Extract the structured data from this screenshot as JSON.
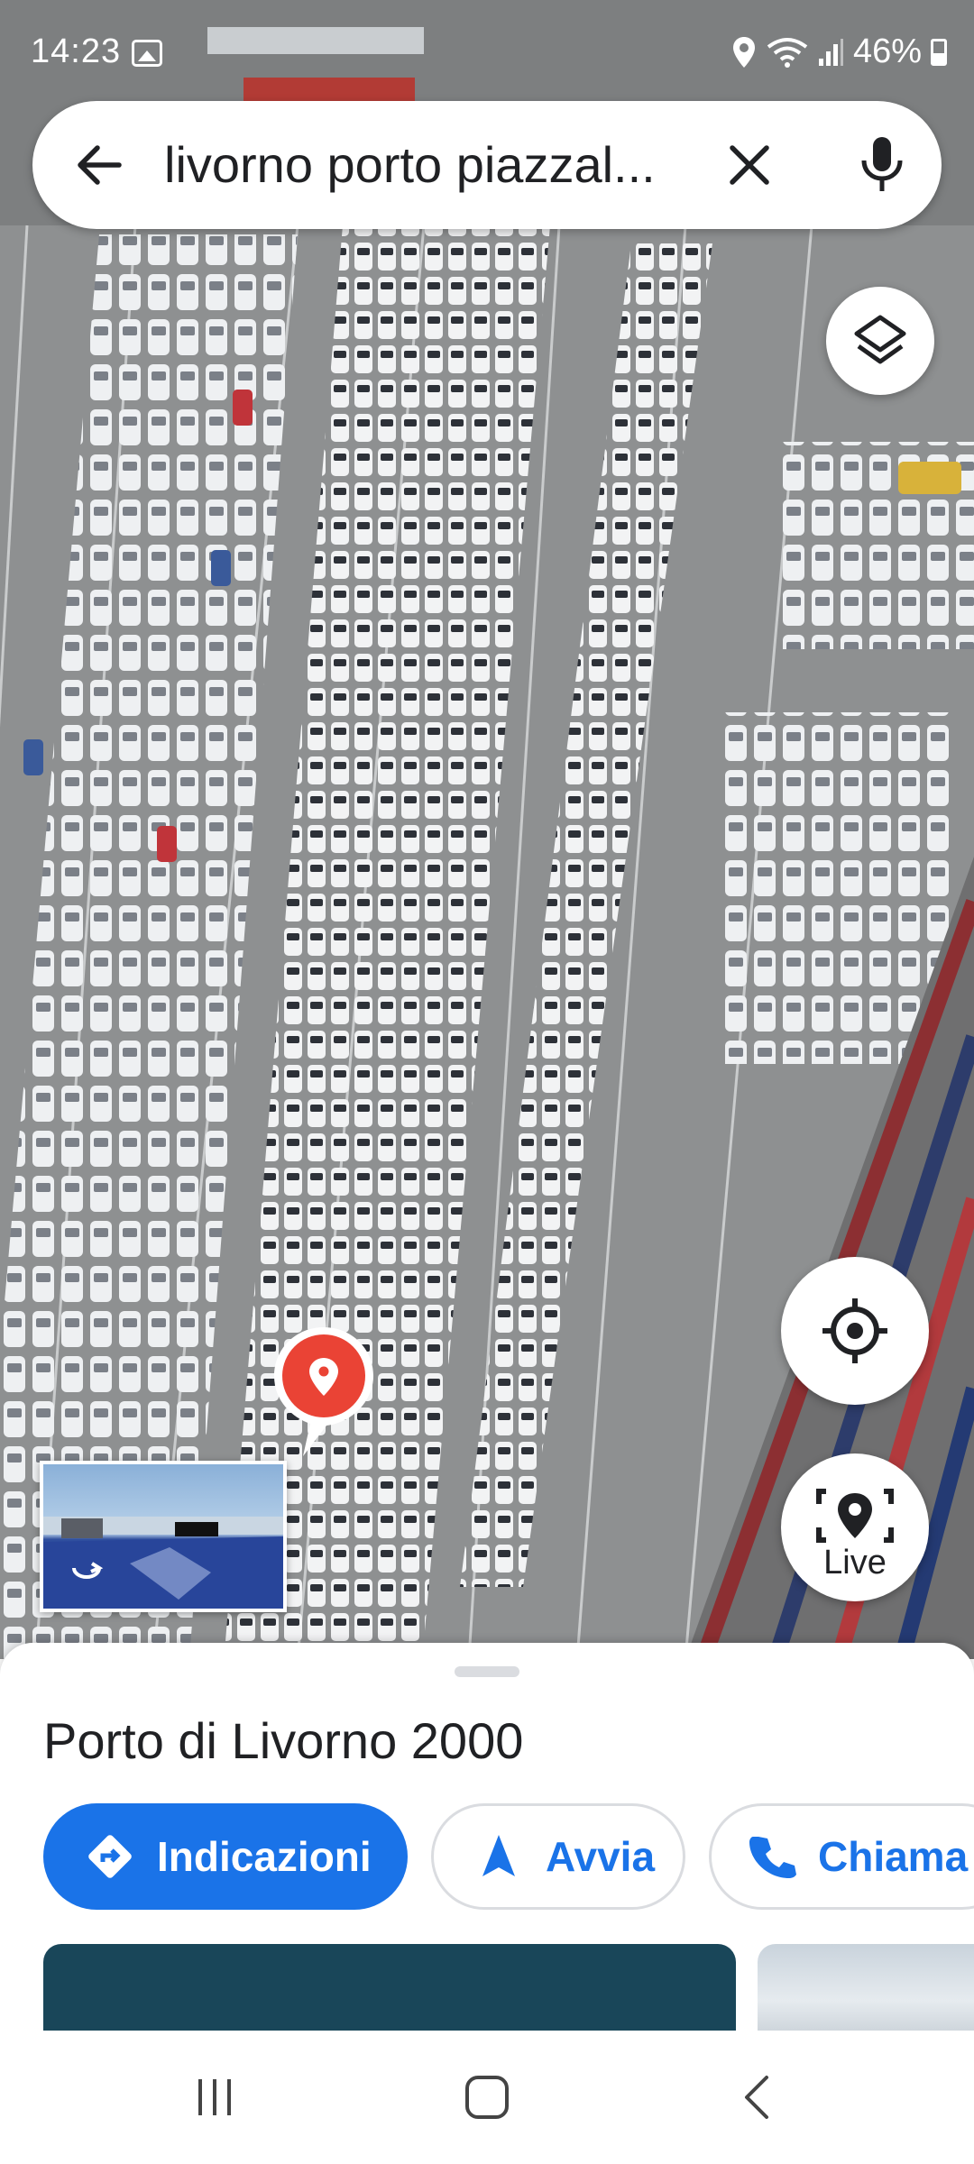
{
  "status_bar": {
    "time": "14:23",
    "battery": "46%"
  },
  "search": {
    "query": "livorno porto piazzal..."
  },
  "map": {
    "live_label": "Live"
  },
  "place": {
    "title": "Porto di Livorno 2000"
  },
  "actions": {
    "directions": "Indicazioni",
    "start": "Avvia",
    "call": "Chiama"
  },
  "colors": {
    "accent": "#1a73e8",
    "pin": "#ea4335"
  }
}
